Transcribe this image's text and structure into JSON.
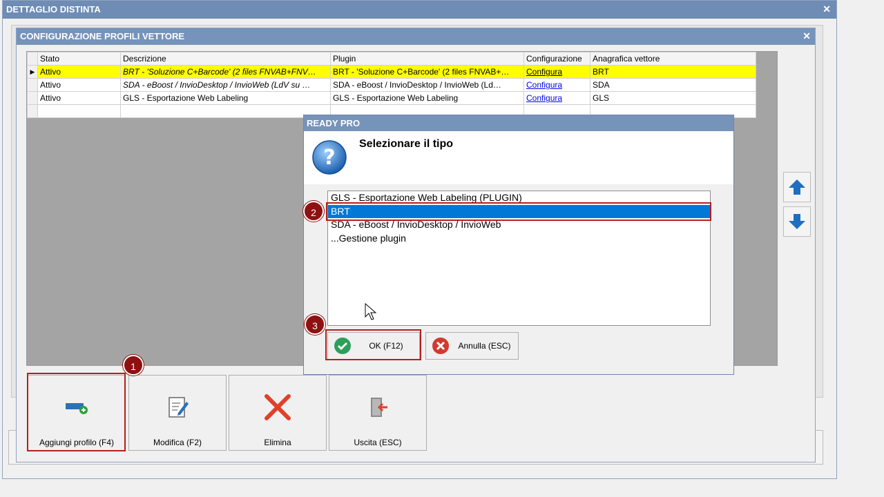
{
  "outer_window": {
    "title": "DETTAGLIO DISTINTA"
  },
  "inner_window": {
    "title": "CONFIGURAZIONE PROFILI VETTORE"
  },
  "grid": {
    "columns": [
      "Stato",
      "Descrizione",
      "Plugin",
      "Configurazione",
      "Anagrafica vettore"
    ],
    "rows": [
      {
        "stato": "Attivo",
        "descrizione": "BRT - 'Soluzione C+Barcode' (2 files FNVAB+FNV…",
        "plugin": "BRT - 'Soluzione C+Barcode' (2 files FNVAB+…",
        "configurazione": "Configura",
        "anagrafica": "BRT"
      },
      {
        "stato": "Attivo",
        "descrizione": "SDA - eBoost / InvioDesktop / InvioWeb (LdV su …",
        "plugin": "SDA - eBoost / InvioDesktop / InvioWeb (Ld…",
        "configurazione": "Configura",
        "anagrafica": "SDA"
      },
      {
        "stato": "Attivo",
        "descrizione": "GLS - Esportazione Web Labeling",
        "plugin": "GLS - Esportazione Web Labeling",
        "configurazione": "Configura",
        "anagrafica": "GLS"
      }
    ]
  },
  "toolbar": {
    "add_label": "Aggiungi profilo (F4)",
    "edit_label": "Modifica (F2)",
    "delete_label": "Elimina",
    "exit_label": "Uscita (ESC)"
  },
  "dialog": {
    "title": "READY PRO",
    "message": "Selezionare il tipo",
    "options": [
      "GLS - Esportazione Web Labeling (PLUGIN)",
      "BRT",
      "SDA - eBoost / InvioDesktop / InvioWeb",
      "...Gestione plugin"
    ],
    "selected_option": "BRT",
    "ok_label": "OK (F12)",
    "cancel_label": "Annulla (ESC)"
  },
  "annotations": [
    "1",
    "2",
    "3"
  ],
  "colors": {
    "highlight": "#b51d1d",
    "title_bar": "#7693ba",
    "selected_row": "#ffff00",
    "list_selection": "#0078d7"
  }
}
